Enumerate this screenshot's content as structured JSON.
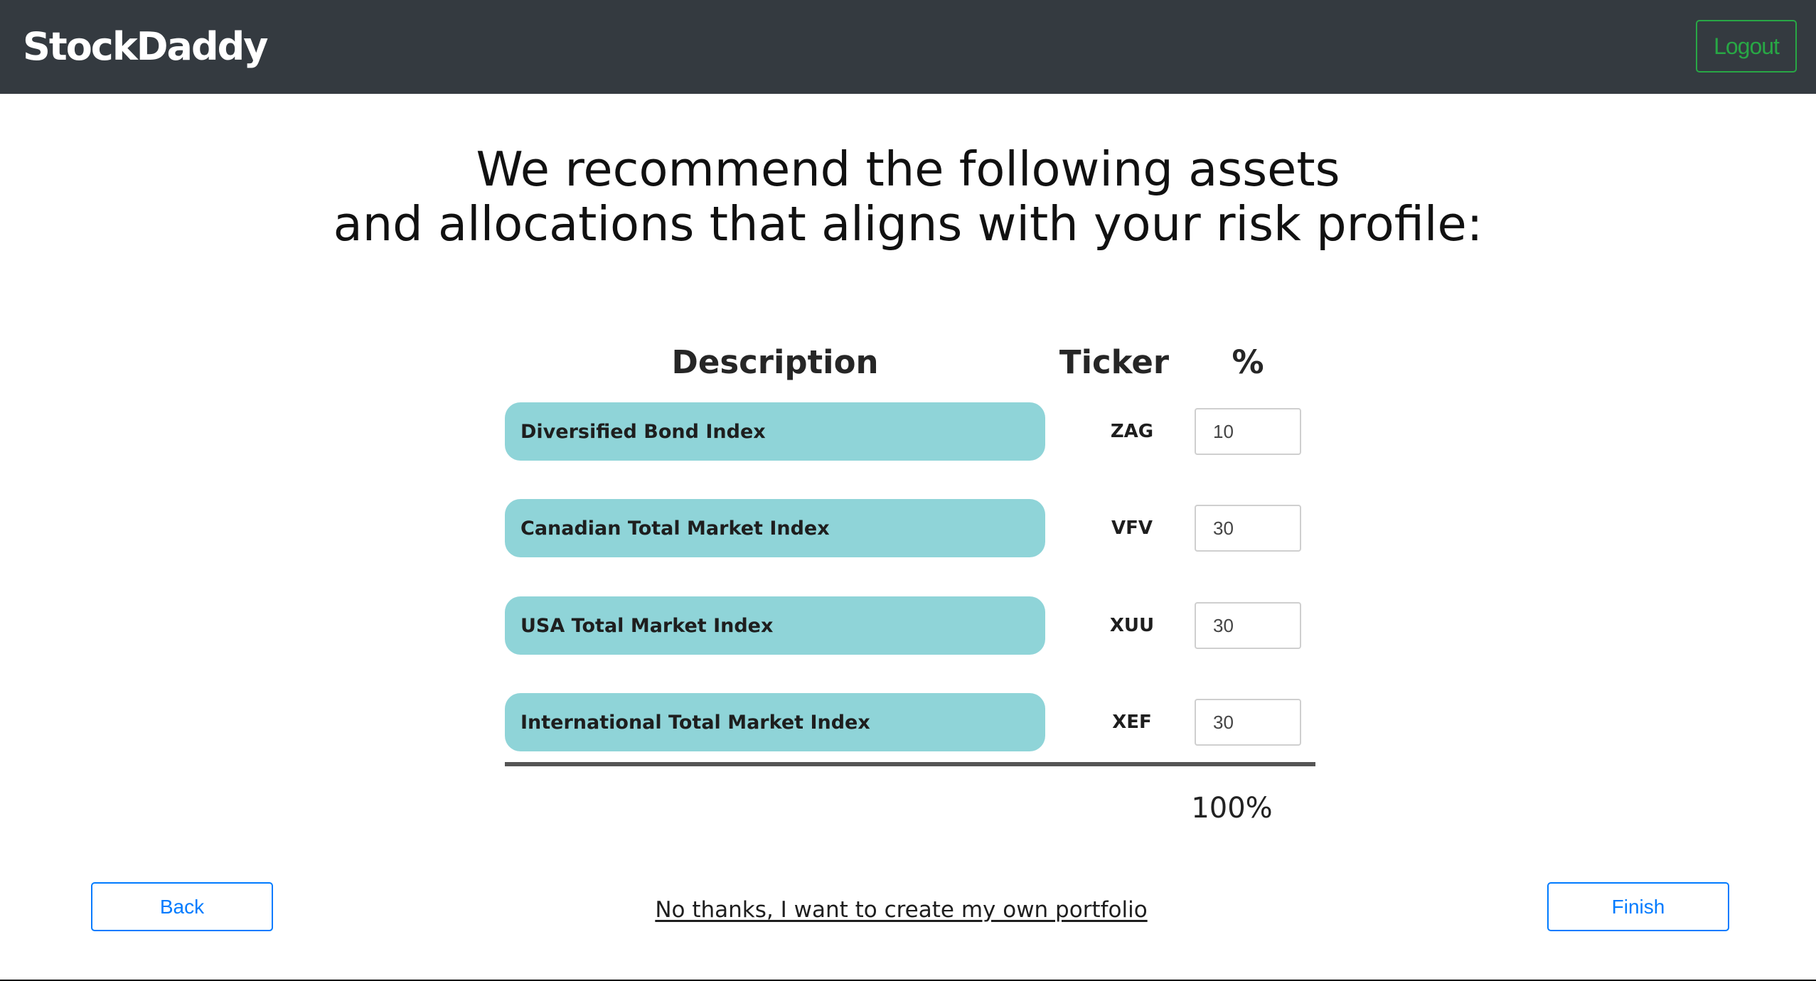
{
  "navbar": {
    "brand": "StockDaddy",
    "logout_label": "Logout"
  },
  "heading": {
    "line1": "We recommend the following assets",
    "line2": "and allocations that aligns with your risk profile:"
  },
  "table": {
    "headers": {
      "description": "Description",
      "ticker": "Ticker",
      "percent": "%"
    },
    "rows": [
      {
        "description": "Diversified Bond Index",
        "ticker": "ZAG",
        "percent": "10"
      },
      {
        "description": "Canadian Total Market Index",
        "ticker": "VFV",
        "percent": "30"
      },
      {
        "description": "USA Total Market Index",
        "ticker": "XUU",
        "percent": "30"
      },
      {
        "description": "International Total Market Index",
        "ticker": "XEF",
        "percent": "30"
      }
    ],
    "total": "100%"
  },
  "actions": {
    "back_label": "Back",
    "finish_label": "Finish",
    "own_portfolio_link": "No thanks, I want to create my own portfolio"
  },
  "colors": {
    "navbar_bg": "#343a40",
    "success": "#28a745",
    "primary": "#007bff",
    "description_pill": "#8fd4d8"
  }
}
